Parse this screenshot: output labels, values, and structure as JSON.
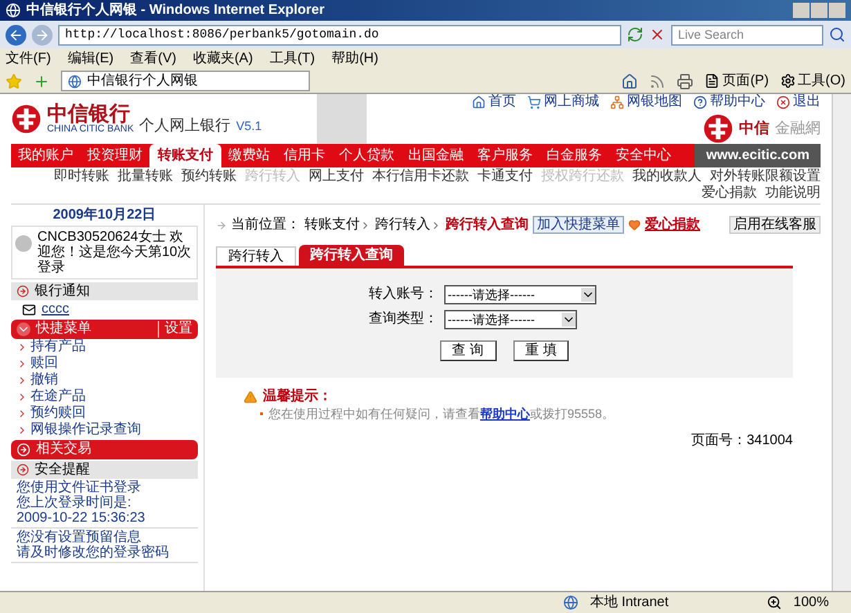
{
  "browser": {
    "title": "中信银行个人网银 - Windows Internet Explorer",
    "url": "http://localhost:8086/perbank5/gotomain.do",
    "search_placeholder": "Live Search",
    "menu": [
      "文件(F)",
      "编辑(E)",
      "查看(V)",
      "收藏夹(A)",
      "工具(T)",
      "帮助(H)"
    ],
    "tab": "中信银行个人网银",
    "toolbar": [
      "页面(P)",
      "工具(O)"
    ]
  },
  "header": {
    "bank_name": "中信银行",
    "bank_name_en": "CHINA CITIC BANK",
    "product": "个人网上银行",
    "version": "V5.1",
    "links": [
      {
        "kind": "home",
        "label": "首页"
      },
      {
        "kind": "cart",
        "label": "网上商城"
      },
      {
        "kind": "map",
        "label": "网银地图"
      },
      {
        "kind": "help",
        "label": "帮助中心"
      },
      {
        "kind": "exit",
        "label": "退出"
      }
    ],
    "partner": "中信",
    "partner_suffix": "金融網"
  },
  "nav": {
    "items": [
      {
        "label": "我的账户",
        "selected": false
      },
      {
        "label": "投资理财",
        "selected": false
      },
      {
        "label": "转账支付",
        "selected": true
      },
      {
        "label": "缴费站",
        "selected": false
      },
      {
        "label": "信用卡",
        "selected": false
      },
      {
        "label": "个人贷款",
        "selected": false
      },
      {
        "label": "出国金融",
        "selected": false
      },
      {
        "label": "客户服务",
        "selected": false
      },
      {
        "label": "白金服务",
        "selected": false
      },
      {
        "label": "安全中心",
        "selected": false
      }
    ],
    "site": "www.ecitic.com"
  },
  "subnav": [
    {
      "label": "即时转账",
      "disabled": false
    },
    {
      "label": "批量转账",
      "disabled": false
    },
    {
      "label": "预约转账",
      "disabled": false
    },
    {
      "label": "跨行转入",
      "disabled": true
    },
    {
      "label": "网上支付",
      "disabled": false
    },
    {
      "label": "本行信用卡还款",
      "disabled": false
    },
    {
      "label": "卡通支付",
      "disabled": false
    },
    {
      "label": "授权跨行还款",
      "disabled": true
    },
    {
      "label": "我的收款人",
      "disabled": false
    },
    {
      "label": "对外转账限额设置",
      "disabled": false
    },
    {
      "label": "爱心捐款",
      "disabled": false
    },
    {
      "label": "功能说明",
      "disabled": false
    }
  ],
  "sidebar": {
    "date": "2009年10月22日",
    "welcome": "CNCB30520624女士 欢迎您！这是您今天第10次登录",
    "notice": {
      "title": "银行通知",
      "items": [
        "cccc"
      ]
    },
    "quick_menu": {
      "title": "快捷菜单",
      "settings": "设置",
      "items": [
        "持有产品",
        "赎回",
        "撤销",
        "在途产品",
        "预约赎回",
        "网银操作记录查询"
      ]
    },
    "related": {
      "title": "相关交易"
    },
    "security": {
      "title": "安全提醒",
      "groups": [
        [
          "您使用文件证书登录",
          "您上次登录时间是:",
          "2009-10-22 15:36:23"
        ],
        [
          "您没有设置预留信息",
          "请及时修改您的登录密码"
        ]
      ]
    }
  },
  "main": {
    "breadcrumb": {
      "label": "当前位置：",
      "path": [
        "转账支付",
        "跨行转入"
      ],
      "current": "跨行转入查询"
    },
    "add_button": "加入快捷菜单",
    "donate": "爱心捐款",
    "online_service": "启用在线客服",
    "tabs": [
      {
        "label": "跨行转入",
        "selected": false
      },
      {
        "label": "跨行转入查询",
        "selected": true
      }
    ],
    "fields": [
      {
        "label": "转入账号：",
        "value": "------请选择------"
      },
      {
        "label": "查询类型：",
        "value": "------请选择------"
      }
    ],
    "buttons": [
      "查 询",
      "重 填"
    ],
    "tip": {
      "title": "温馨提示：",
      "before": "您在使用过程中如有任何疑问，请查看",
      "link": "帮助中心",
      "after": "或拨打95558。"
    },
    "page_no": "页面号：341004"
  },
  "status_bar": {
    "zone": "本地 Intranet",
    "zoom": "100%"
  }
}
